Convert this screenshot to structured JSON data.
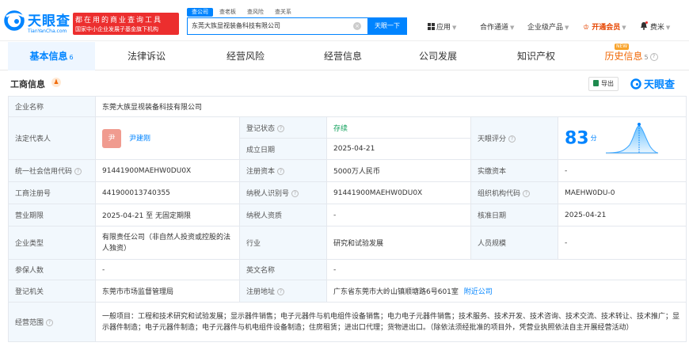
{
  "brand": {
    "name": "天眼查",
    "domain": "TianYanCha.com"
  },
  "slogan": {
    "line1": "都在用的商业查询工具",
    "line2": "国家中小企业发展子基金旗下机构"
  },
  "search": {
    "tabs": [
      "查公司",
      "查老板",
      "查风险",
      "查关系"
    ],
    "value": "东莞大族显视装备科技有限公司",
    "clear_label": "×",
    "button_label": "天眼一下"
  },
  "header_nav": {
    "apps": "应用",
    "partner": "合作通道",
    "enterprise": "企业级产品",
    "vip": "开通会员",
    "user": "费米"
  },
  "tabs": [
    {
      "label": "基本信息",
      "count": "6"
    },
    {
      "label": "法律诉讼",
      "count": ""
    },
    {
      "label": "经营风险",
      "count": ""
    },
    {
      "label": "经营信息",
      "count": ""
    },
    {
      "label": "公司发展",
      "count": ""
    },
    {
      "label": "知识产权",
      "count": ""
    },
    {
      "label": "历史信息",
      "count": "5",
      "tag": "NEW"
    }
  ],
  "section": {
    "title": "工商信息",
    "export_label": "导出",
    "brand_label": "天眼查"
  },
  "info": {
    "company_name_label": "企业名称",
    "company_name": "东莞大族显视装备科技有限公司",
    "legal_rep_label": "法定代表人",
    "legal_rep_avatar": "尹",
    "legal_rep": "尹建刚",
    "reg_status_label": "登记状态",
    "reg_status": "存续",
    "founded_label": "成立日期",
    "founded": "2025-04-21",
    "score_label": "天眼评分",
    "score": "83",
    "score_unit": "分",
    "credit_code_label": "统一社会信用代码",
    "credit_code": "91441900MAEHW0DU0X",
    "reg_capital_label": "注册资本",
    "reg_capital": "5000万人民币",
    "paid_capital_label": "实缴资本",
    "paid_capital": "-",
    "reg_no_label": "工商注册号",
    "reg_no": "441900013740355",
    "taxpayer_id_label": "纳税人识别号",
    "taxpayer_id": "91441900MAEHW0DU0X",
    "org_code_label": "组织机构代码",
    "org_code": "MAEHW0DU-0",
    "term_label": "营业期限",
    "term": "2025-04-21 至 无固定期限",
    "taxpayer_qual_label": "纳税人资质",
    "taxpayer_qual": "-",
    "approval_label": "核准日期",
    "approval": "2025-04-21",
    "type_label": "企业类型",
    "type": "有限责任公司（非自然人投资或控股的法人独资）",
    "industry_label": "行业",
    "industry": "研究和试验发展",
    "staff_label": "人员规模",
    "staff": "-",
    "insured_label": "参保人数",
    "insured": "-",
    "en_name_label": "英文名称",
    "en_name": "-",
    "authority_label": "登记机关",
    "authority": "东莞市市场监督管理局",
    "address_label": "注册地址",
    "address": "广东省东莞市大岭山镇顺塘路6号601室",
    "nearby_label": "附近公司",
    "scope_label": "经营范围",
    "scope": "一般项目：工程和技术研究和试验发展；显示器件销售；电子元器件与机电组件设备销售；电力电子元器件销售；技术服务、技术开发、技术咨询、技术交流、技术转让、技术推广；显示器件制造；电子元器件制造；电子元器件与机电组件设备制造；住房租赁；进出口代理；货物进出口。（除依法须经批准的项目外，凭营业执照依法自主开展经营活动）"
  },
  "colors": {
    "accent": "#0084ff",
    "alert": "#ec2e2e",
    "active": "#12a15c",
    "history": "#f06a0a"
  }
}
